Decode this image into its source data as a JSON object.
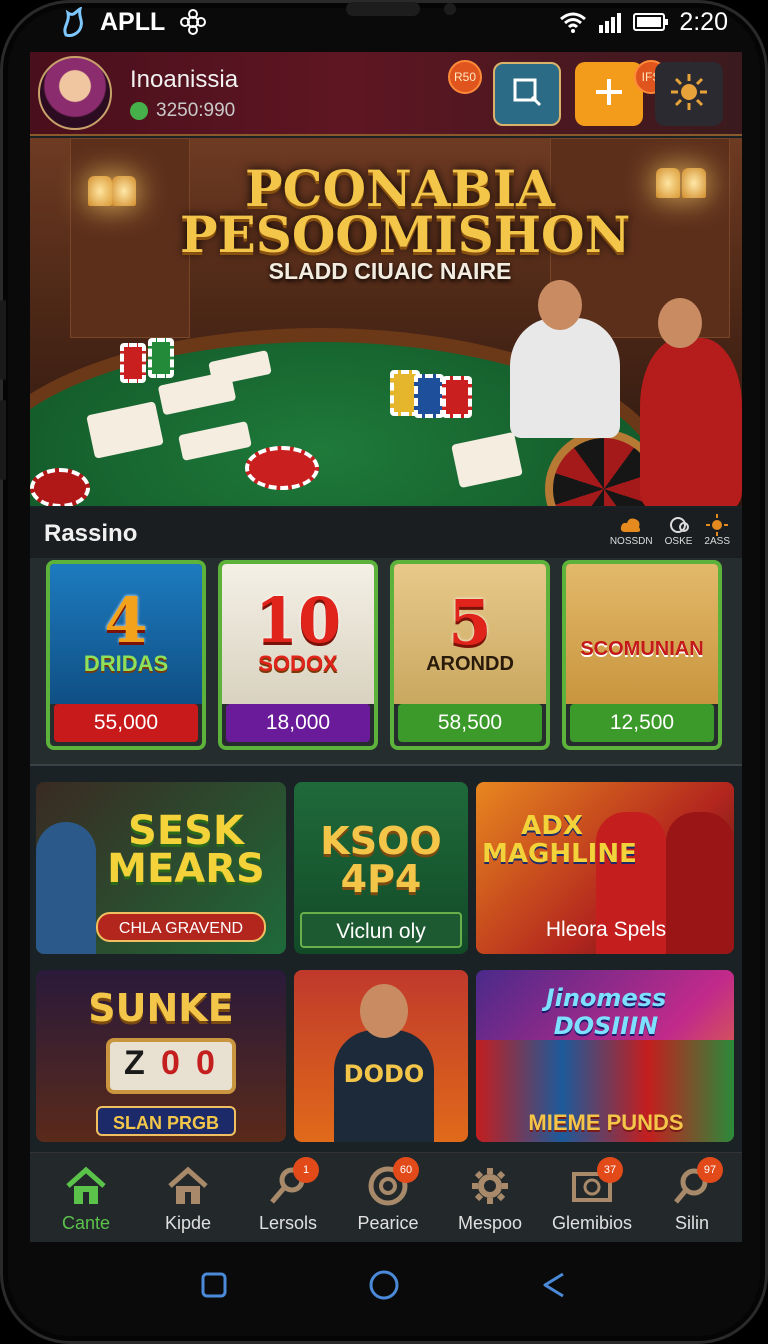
{
  "status_bar": {
    "carrier": "APLL",
    "time": "2:20"
  },
  "header": {
    "username": "Inoanissia",
    "balance": "3250:990",
    "badge_left": "R50",
    "badge_right": "IFS"
  },
  "banner": {
    "title_line1": "PCONABIA",
    "title_line2": "PESOOMISHON",
    "subtitle": "SLADD CIUAIC NAIRE"
  },
  "section": {
    "title": "Rassino",
    "tools": [
      "NOSSDN",
      "OSKE",
      "2ASS"
    ]
  },
  "featured_games": [
    {
      "art_main": "4",
      "art_text": "DRIDAS",
      "price": "55,000",
      "price_color": "#c8191b"
    },
    {
      "art_main": "10",
      "art_text": "SODOX",
      "price": "18,000",
      "price_color": "#6a1b9a"
    },
    {
      "art_main": "5",
      "art_text": "ARONDD",
      "price": "58,500",
      "price_color": "#3c9a2a"
    },
    {
      "art_main": "",
      "art_text": "SCOMUNIAN",
      "price": "12,500",
      "price_color": "#3c9a2a"
    }
  ],
  "tiles": [
    {
      "title": "SESK MEARS",
      "ribbon": "CHLA GRAVEND",
      "label": ""
    },
    {
      "title": "KSOO 4P4",
      "ribbon": "",
      "label": "Viclun oly"
    },
    {
      "title": "ADX MAGHLINE",
      "ribbon": "",
      "label": "Hleora Spels"
    },
    {
      "title": "SUNKE",
      "ribbon": "SLAN PRGB",
      "label": ""
    },
    {
      "title": "DODO",
      "ribbon": "",
      "label": ""
    },
    {
      "title": "Jinomess DOSIIIN",
      "ribbon": "MIEME PUNDS",
      "label": ""
    }
  ],
  "bottom_nav": [
    {
      "label": "Cante",
      "icon": "home-icon",
      "badge": ""
    },
    {
      "label": "Kipde",
      "icon": "house-icon",
      "badge": ""
    },
    {
      "label": "Lersols",
      "icon": "key-icon",
      "badge": "1"
    },
    {
      "label": "Pearice",
      "icon": "chip-icon",
      "badge": "60"
    },
    {
      "label": "Mespoo",
      "icon": "gear-icon",
      "badge": ""
    },
    {
      "label": "Glemibios",
      "icon": "ticket-icon",
      "badge": "37"
    },
    {
      "label": "Silin",
      "icon": "search-icon",
      "badge": "97"
    }
  ],
  "colors": {
    "accent_orange": "#f39c1b",
    "accent_green": "#5cb23a",
    "nav_active": "#5bc34a",
    "header_bg": "#5e1622"
  }
}
